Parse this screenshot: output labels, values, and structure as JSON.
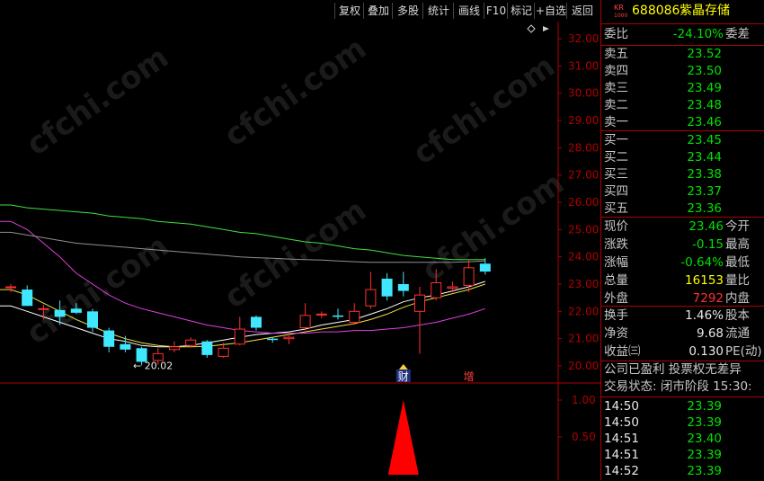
{
  "toolbar": {
    "buttons": [
      "复权",
      "叠加",
      "多股",
      "统计",
      "画线",
      "F10",
      "标记",
      "+自选",
      "返回"
    ]
  },
  "stock": {
    "market_badge_top": "KR",
    "market_badge_bottom": "1000",
    "code": "688086",
    "name": "紫晶存储"
  },
  "order_book": {
    "wei_bi_label": "委比",
    "wei_bi_value": "-24.10%",
    "wei_cha_label": "委差",
    "asks": [
      {
        "label": "卖五",
        "price": "23.52"
      },
      {
        "label": "卖四",
        "price": "23.50"
      },
      {
        "label": "卖三",
        "price": "23.49"
      },
      {
        "label": "卖二",
        "price": "23.48"
      },
      {
        "label": "卖一",
        "price": "23.46"
      }
    ],
    "bids": [
      {
        "label": "买一",
        "price": "23.45"
      },
      {
        "label": "买二",
        "price": "23.44"
      },
      {
        "label": "买三",
        "price": "23.38"
      },
      {
        "label": "买四",
        "price": "23.37"
      },
      {
        "label": "买五",
        "price": "23.36"
      }
    ]
  },
  "quote": [
    {
      "label": "现价",
      "value": "23.46",
      "suffix": "今开",
      "color": "green"
    },
    {
      "label": "涨跌",
      "value": "-0.15",
      "suffix": "最高",
      "color": "green"
    },
    {
      "label": "涨幅",
      "value": "-0.64%",
      "suffix": "最低",
      "color": "green"
    },
    {
      "label": "总量",
      "value": "16153",
      "suffix": "量比",
      "color": "yellow"
    },
    {
      "label": "外盘",
      "value": "7292",
      "suffix": "内盘",
      "color": "red"
    }
  ],
  "fundamentals": [
    {
      "label": "换手",
      "value": "1.46%",
      "suffix": "股本"
    },
    {
      "label": "净资",
      "value": "9.68",
      "suffix": "流通"
    },
    {
      "label": "收益㈢",
      "value": "0.130",
      "suffix": "PE(动)"
    }
  ],
  "notice": "公司已盈利 投票权无差异",
  "trade_status": "交易状态: 闭市阶段 15:30:",
  "ticks": [
    {
      "time": "14:50",
      "price": "23.39",
      "color": "green"
    },
    {
      "time": "14:50",
      "price": "23.39",
      "color": "green"
    },
    {
      "time": "14:51",
      "price": "23.40",
      "color": "green"
    },
    {
      "time": "14:51",
      "price": "23.39",
      "color": "green"
    },
    {
      "time": "14:52",
      "price": "23.39",
      "color": "green"
    }
  ],
  "chart_data": {
    "type": "candlestick",
    "y_axis_ticks": [
      "32.00",
      "31.00",
      "30.00",
      "29.00",
      "28.00",
      "27.00",
      "26.00",
      "25.00",
      "24.00",
      "23.00",
      "22.00",
      "21.00",
      "20.00"
    ],
    "ylim": [
      19.6,
      32.4
    ],
    "low_annotation": "20.02",
    "event_markers": [
      {
        "label": "财",
        "index": 24
      },
      {
        "label": "增",
        "index": 28
      }
    ],
    "candles": [
      {
        "o": 22.9,
        "h": 23.0,
        "l": 22.7,
        "c": 22.9
      },
      {
        "o": 22.8,
        "h": 22.95,
        "l": 22.2,
        "c": 22.2
      },
      {
        "o": 22.1,
        "h": 22.25,
        "l": 21.7,
        "c": 22.1
      },
      {
        "o": 22.05,
        "h": 22.4,
        "l": 21.5,
        "c": 21.8
      },
      {
        "o": 22.1,
        "h": 22.3,
        "l": 21.9,
        "c": 21.95
      },
      {
        "o": 22.0,
        "h": 22.1,
        "l": 21.25,
        "c": 21.4
      },
      {
        "o": 21.3,
        "h": 21.4,
        "l": 20.5,
        "c": 20.7
      },
      {
        "o": 20.8,
        "h": 21.1,
        "l": 20.5,
        "c": 20.6
      },
      {
        "o": 20.65,
        "h": 20.7,
        "l": 20.02,
        "c": 20.15
      },
      {
        "o": 20.2,
        "h": 20.65,
        "l": 20.05,
        "c": 20.45
      },
      {
        "o": 20.6,
        "h": 20.9,
        "l": 20.5,
        "c": 20.7
      },
      {
        "o": 20.75,
        "h": 21.05,
        "l": 20.7,
        "c": 20.95
      },
      {
        "o": 20.9,
        "h": 20.95,
        "l": 20.3,
        "c": 20.4
      },
      {
        "o": 20.35,
        "h": 20.85,
        "l": 20.3,
        "c": 20.65
      },
      {
        "o": 20.8,
        "h": 21.8,
        "l": 20.75,
        "c": 21.35
      },
      {
        "o": 21.8,
        "h": 21.85,
        "l": 21.3,
        "c": 21.4
      },
      {
        "o": 21.0,
        "h": 21.05,
        "l": 20.85,
        "c": 20.95
      },
      {
        "o": 21.0,
        "h": 21.1,
        "l": 20.8,
        "c": 21.05
      },
      {
        "o": 21.4,
        "h": 22.3,
        "l": 21.3,
        "c": 21.85
      },
      {
        "o": 21.9,
        "h": 22.0,
        "l": 21.75,
        "c": 21.9
      },
      {
        "o": 21.85,
        "h": 22.1,
        "l": 21.7,
        "c": 21.8
      },
      {
        "o": 21.6,
        "h": 22.3,
        "l": 21.5,
        "c": 22.0
      },
      {
        "o": 22.2,
        "h": 23.45,
        "l": 22.1,
        "c": 22.8
      },
      {
        "o": 23.2,
        "h": 23.4,
        "l": 22.4,
        "c": 22.55
      },
      {
        "o": 23.0,
        "h": 23.45,
        "l": 22.55,
        "c": 22.75
      },
      {
        "o": 22.0,
        "h": 22.9,
        "l": 20.45,
        "c": 22.6
      },
      {
        "o": 22.5,
        "h": 23.55,
        "l": 22.4,
        "c": 23.05
      },
      {
        "o": 22.85,
        "h": 23.1,
        "l": 22.7,
        "c": 22.9
      },
      {
        "o": 22.95,
        "h": 23.9,
        "l": 22.7,
        "c": 23.6
      },
      {
        "o": 23.75,
        "h": 23.95,
        "l": 23.35,
        "c": 23.46
      }
    ],
    "ma_lines": [
      {
        "color": "#ffffff",
        "values": [
          22.2,
          22.0,
          21.8,
          21.6,
          21.4,
          21.2,
          21.0,
          20.9,
          20.75,
          20.7,
          20.7,
          20.75,
          20.85,
          20.95,
          21.05,
          21.15,
          21.2,
          21.25,
          21.35,
          21.5,
          21.6,
          21.7,
          21.9,
          22.1,
          22.35,
          22.5,
          22.6,
          22.75,
          22.9,
          23.1
        ]
      },
      {
        "color": "#f0e040",
        "values": [
          22.8,
          22.6,
          22.3,
          22.0,
          21.7,
          21.45,
          21.2,
          21.0,
          20.85,
          20.75,
          20.7,
          20.7,
          20.72,
          20.78,
          20.85,
          20.95,
          21.05,
          21.15,
          21.25,
          21.35,
          21.45,
          21.55,
          21.7,
          21.9,
          22.15,
          22.35,
          22.5,
          22.65,
          22.8,
          23.0
        ]
      },
      {
        "color": "#e040e0",
        "values": [
          25.3,
          25.0,
          24.5,
          24.0,
          23.4,
          23.0,
          22.6,
          22.3,
          22.1,
          21.95,
          21.8,
          21.65,
          21.5,
          21.4,
          21.3,
          21.25,
          21.2,
          21.2,
          21.2,
          21.25,
          21.25,
          21.3,
          21.3,
          21.35,
          21.4,
          21.5,
          21.6,
          21.75,
          21.9,
          22.1
        ]
      },
      {
        "color": "#40e040",
        "values": [
          25.9,
          25.8,
          25.75,
          25.7,
          25.65,
          25.6,
          25.5,
          25.45,
          25.4,
          25.3,
          25.25,
          25.2,
          25.1,
          25.0,
          24.9,
          24.85,
          24.75,
          24.65,
          24.55,
          24.5,
          24.4,
          24.3,
          24.25,
          24.15,
          24.05,
          24.0,
          23.95,
          23.9,
          23.9,
          23.9
        ]
      },
      {
        "color": "#909090",
        "values": [
          24.9,
          24.8,
          24.7,
          24.6,
          24.5,
          24.45,
          24.4,
          24.35,
          24.3,
          24.25,
          24.2,
          24.15,
          24.1,
          24.05,
          24.0,
          23.97,
          23.95,
          23.92,
          23.9,
          23.88,
          23.85,
          23.82,
          23.8,
          23.8,
          23.8,
          23.8,
          23.8,
          23.8,
          23.82,
          23.85
        ]
      }
    ],
    "indicator": {
      "y_axis_ticks": [
        "1.00",
        "0.50"
      ],
      "ylim": [
        0,
        1.05
      ],
      "spike_index": 24,
      "spike_value": 1.0
    }
  },
  "watermark": "cfchi.com"
}
